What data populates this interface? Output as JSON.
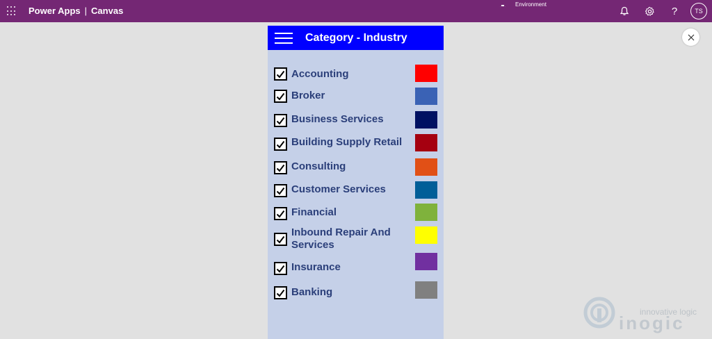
{
  "topbar": {
    "app_name": "Power Apps",
    "separator": "|",
    "app_type": "Canvas",
    "environment_label": "Environment",
    "avatar_initials": "TS",
    "help_symbol": "?",
    "icons": [
      "waffle-icon",
      "environment-icon",
      "bell-icon",
      "gear-icon",
      "help-icon"
    ],
    "bg_color": "#742774"
  },
  "close_icon": "close-icon",
  "panel": {
    "title": "Category - Industry",
    "header_color": "#0000ff",
    "bg_color": "#c5d0e8",
    "menu_icon": "hamburger-icon",
    "items": [
      {
        "label": "Accounting",
        "checked": true,
        "color": "#ff0000"
      },
      {
        "label": "Broker",
        "checked": true,
        "color": "#3a62b5"
      },
      {
        "label": "Business Services",
        "checked": true,
        "color": "#001162"
      },
      {
        "label": "Building Supply Retail",
        "checked": true,
        "color": "#a50010"
      },
      {
        "label": "Consulting",
        "checked": true,
        "color": "#e15016"
      },
      {
        "label": "Customer Services",
        "checked": true,
        "color": "#015e98"
      },
      {
        "label": "Financial",
        "checked": true,
        "color": "#7fb23c"
      },
      {
        "label": "Inbound Repair And Services",
        "checked": true,
        "color": "#ffff00"
      },
      {
        "label": "Insurance",
        "checked": true,
        "color": "#7130a0"
      },
      {
        "label": "Banking",
        "checked": true,
        "color": "#808080"
      }
    ]
  },
  "watermark": {
    "tagline": "innovative logic",
    "brand": "inogic"
  }
}
